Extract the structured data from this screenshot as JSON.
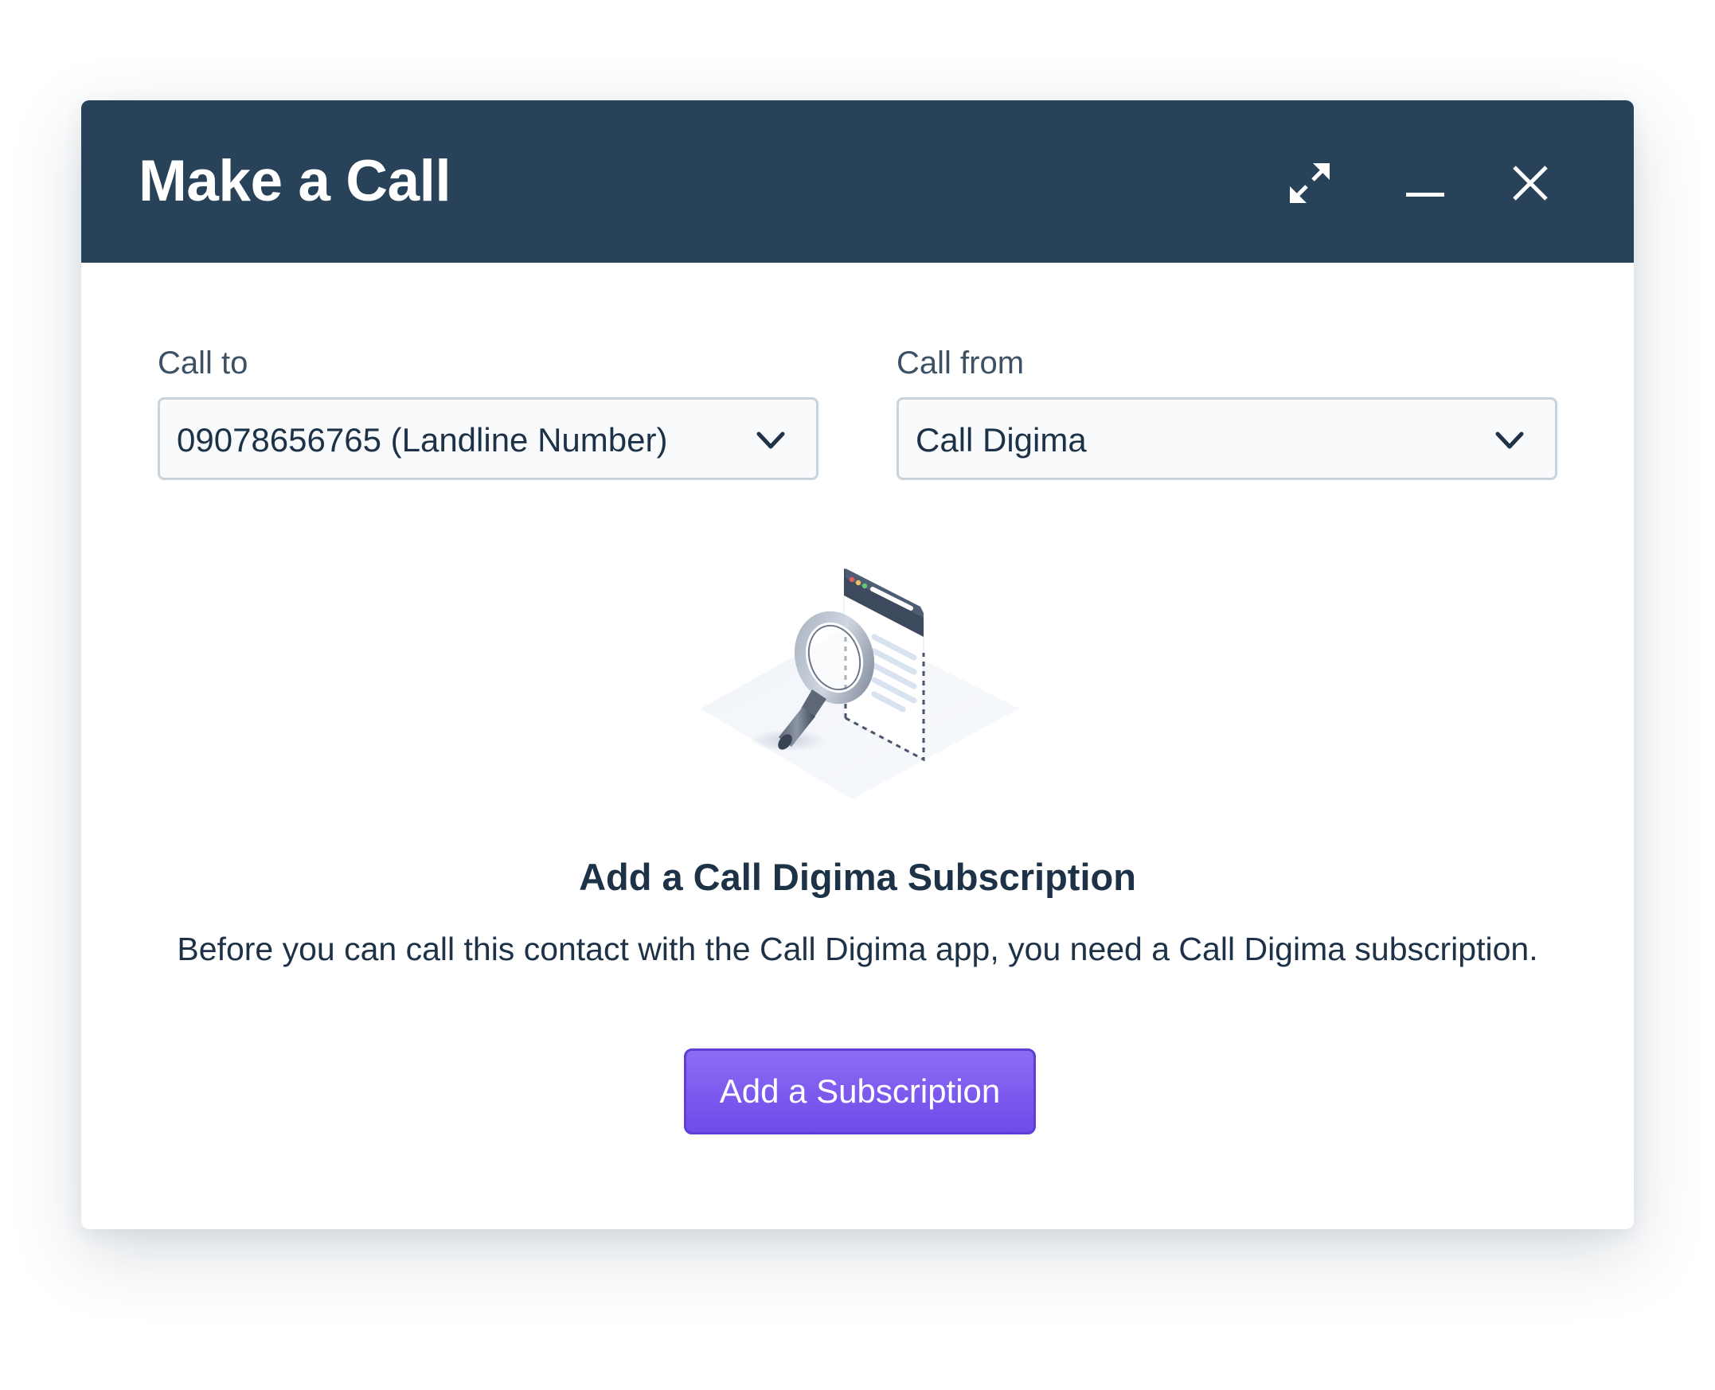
{
  "dialog": {
    "title": "Make a Call",
    "header_bg": "#274259",
    "controls": {
      "expand_icon": "expand-arrows-icon",
      "minimize_icon": "minimize-icon",
      "close_icon": "close-icon"
    }
  },
  "form": {
    "call_to": {
      "label": "Call to",
      "value": "09078656765 (Landline Number)",
      "icon": "chevron-down-icon"
    },
    "call_from": {
      "label": "Call from",
      "value": "Call Digima",
      "icon": "chevron-down-icon"
    }
  },
  "empty_state": {
    "illustration": "magnifier-over-document-illustration",
    "title": "Add a Call Digima Subscription",
    "description": "Before you can call this contact with the Call Digima app, you need a Call Digima subscription.",
    "button_label": "Add a Subscription",
    "button_color": "#7a57ee"
  }
}
